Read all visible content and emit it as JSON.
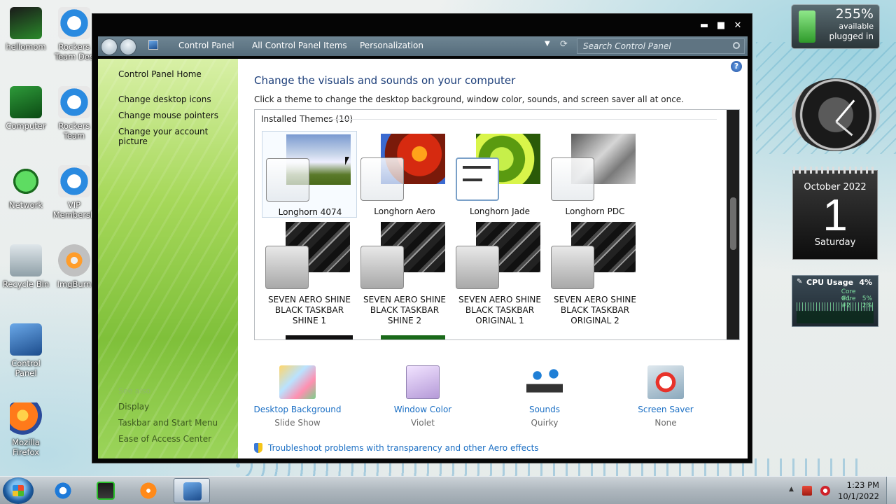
{
  "desktop": {
    "icons": [
      {
        "label": "hellomom"
      },
      {
        "label": "Rockers Team Des"
      },
      {
        "label": "Computer"
      },
      {
        "label": "Rockers Team"
      },
      {
        "label": "Network"
      },
      {
        "label": "VIP Membersh"
      },
      {
        "label": "Recycle Bin"
      },
      {
        "label": "ImgBurn"
      },
      {
        "label": "Control Panel"
      },
      {
        "label": "Mozilla Firefox"
      }
    ]
  },
  "window": {
    "controls": {
      "minimize": "▬",
      "maximize": "■",
      "close": "✕"
    },
    "breadcrumbs": [
      "Control Panel",
      "All Control Panel Items",
      "Personalization"
    ],
    "search_placeholder": "Search Control Panel",
    "sidebar": {
      "home": "Control Panel Home",
      "links": [
        "Change desktop icons",
        "Change mouse pointers",
        "Change your account picture"
      ],
      "see_also_header": "See also",
      "see_also": [
        "Display",
        "Taskbar and Start Menu",
        "Ease of Access Center"
      ]
    },
    "main": {
      "title": "Change the visuals and sounds on your computer",
      "subtitle": "Click a theme to change the desktop background, window color, sounds, and screen saver all at once.",
      "help": "?",
      "themes_header": "Installed Themes (10)",
      "themes": [
        {
          "name": "Longhorn 4074",
          "selected": true
        },
        {
          "name": "Longhorn Aero"
        },
        {
          "name": "Longhorn Jade"
        },
        {
          "name": "Longhorn PDC"
        },
        {
          "name": "SEVEN AERO SHINE BLACK TASKBAR SHINE 1"
        },
        {
          "name": "SEVEN AERO SHINE BLACK TASKBAR SHINE 2"
        },
        {
          "name": "SEVEN AERO SHINE BLACK TASKBAR ORIGINAL 1"
        },
        {
          "name": "SEVEN AERO SHINE BLACK TASKBAR ORIGINAL 2"
        }
      ],
      "options": [
        {
          "name": "Desktop Background",
          "value": "Slide Show",
          "icon": "desktop-background-icon"
        },
        {
          "name": "Window Color",
          "value": "Violet",
          "icon": "window-color-icon"
        },
        {
          "name": "Sounds",
          "value": "Quirky",
          "icon": "sounds-icon"
        },
        {
          "name": "Screen Saver",
          "value": "None",
          "icon": "screen-saver-icon"
        }
      ],
      "troubleshoot": "Troubleshoot problems with transparency and other Aero effects"
    }
  },
  "gadgets": {
    "battery": {
      "percent": "255%",
      "line1": "available",
      "line2": "plugged in"
    },
    "calendar": {
      "month": "October 2022",
      "day": "1",
      "weekday": "Saturday"
    },
    "cpu": {
      "title": "CPU Usage",
      "percent": "4%",
      "cores": [
        {
          "name": "Core #1",
          "value": "5%"
        },
        {
          "name": "Core #2",
          "value": "2%"
        }
      ]
    }
  },
  "taskbar": {
    "time": "1:23 PM",
    "date": "10/1/2022",
    "tray_arrow": "▲"
  }
}
